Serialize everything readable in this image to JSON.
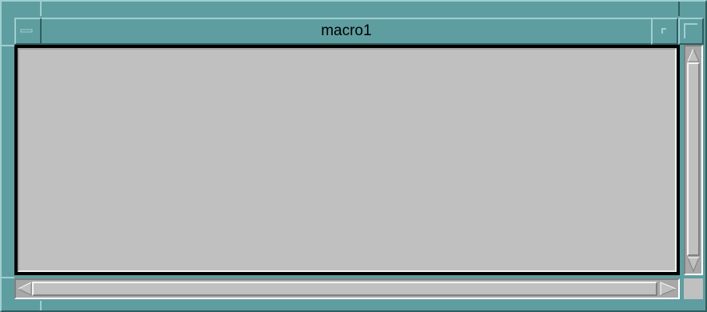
{
  "window": {
    "title": "macro1"
  },
  "icons": {
    "window_menu": "window-menu-icon",
    "minimize": "minimize-icon",
    "maximize": "maximize-icon",
    "scroll_up": "scroll-up-arrow-icon",
    "scroll_down": "scroll-down-arrow-icon",
    "scroll_left": "scroll-left-arrow-icon",
    "scroll_right": "scroll-right-arrow-icon"
  },
  "colors": {
    "frame": "#5f9ea0",
    "client": "#c0c0c0"
  }
}
